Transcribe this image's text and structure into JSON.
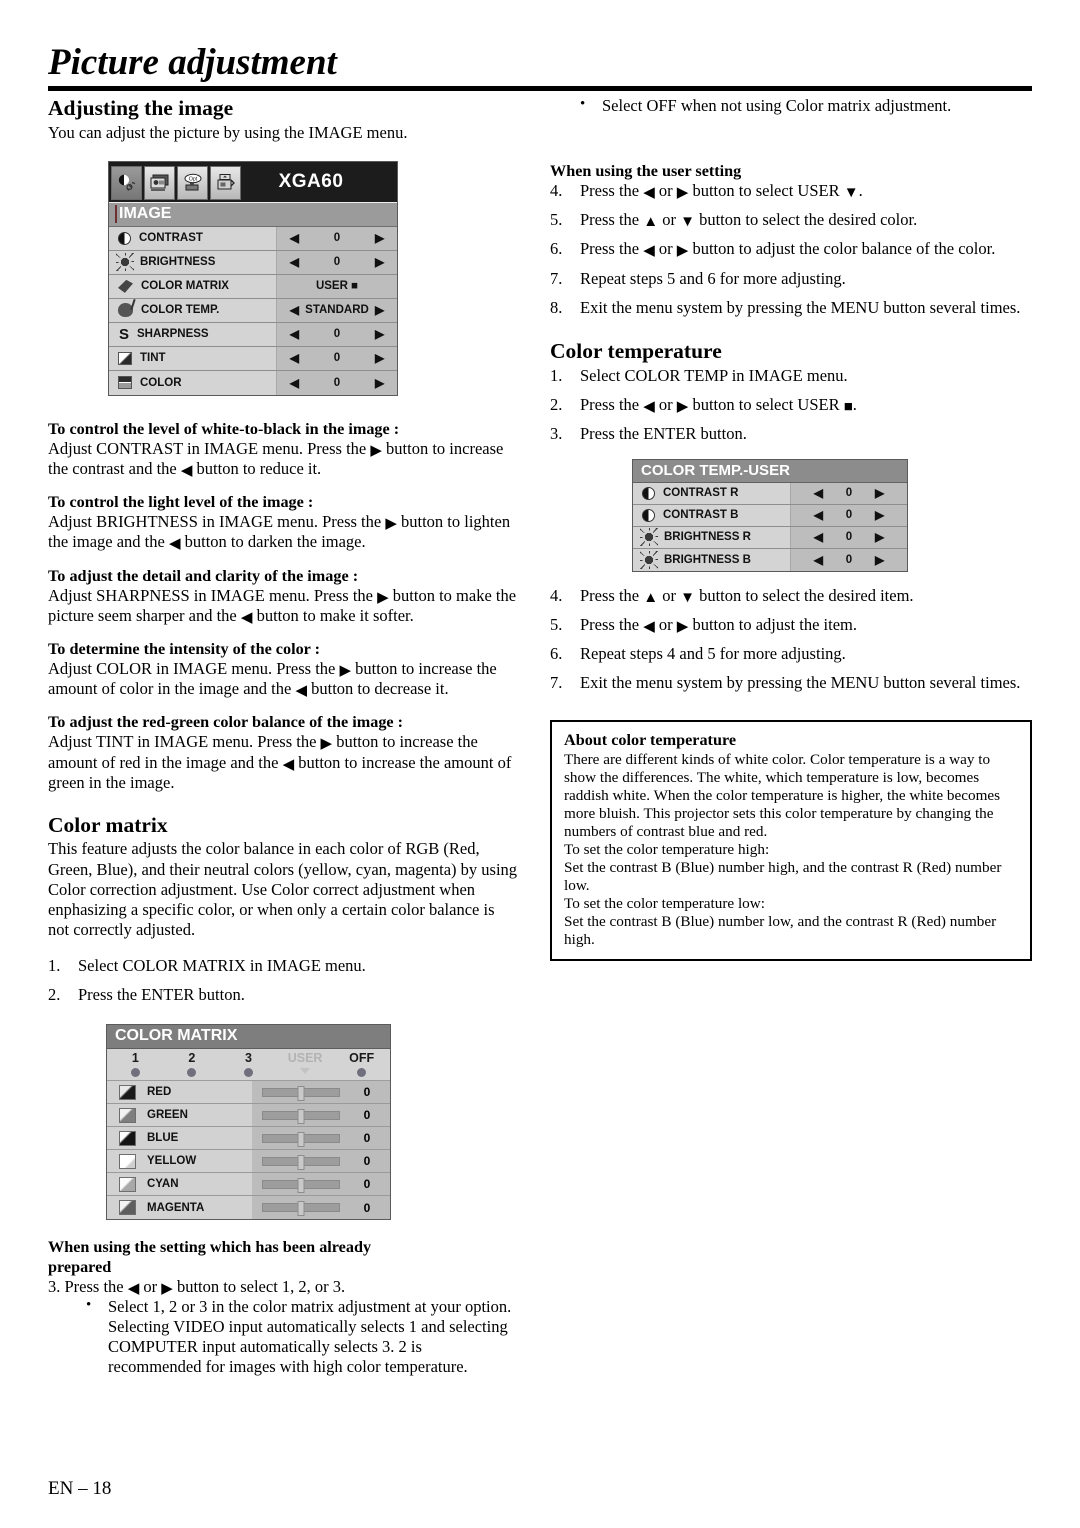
{
  "page": {
    "title": "Picture adjustment",
    "footer": "EN – 18"
  },
  "left_column": {
    "section_adjusting": {
      "heading": "Adjusting the image",
      "intro": "You can adjust the picture by using the IMAGE menu."
    },
    "image_menu": {
      "name": "IMAGE",
      "signal": "XGA60",
      "tabs": [
        "image-tab-icon",
        "display-tab-icon",
        "option-tab-icon",
        "signal-tab-icon"
      ],
      "rows": [
        {
          "icon": "contrast-icon",
          "label": "CONTRAST",
          "value": "0",
          "has_arrows": true
        },
        {
          "icon": "brightness-icon",
          "label": "BRIGHTNESS",
          "value": "0",
          "has_arrows": true
        },
        {
          "icon": "color-matrix-icon",
          "label": "COLOR MATRIX",
          "value": "USER ■",
          "has_arrows": false
        },
        {
          "icon": "color-temp-icon",
          "label": "COLOR TEMP.",
          "value": "STANDARD",
          "has_arrows": true
        },
        {
          "icon": "sharpness-icon",
          "label": "SHARPNESS",
          "value": "0",
          "has_arrows": true
        },
        {
          "icon": "tint-icon",
          "label": "TINT",
          "value": "0",
          "has_arrows": true
        },
        {
          "icon": "color-icon",
          "label": "COLOR",
          "value": "0",
          "has_arrows": true
        }
      ]
    },
    "topics": [
      {
        "heading": "To control the level of white-to-black in the image :",
        "body_parts": [
          {
            "t": "Adjust CONTRAST in IMAGE menu.  Press the "
          },
          {
            "g": "tri-r"
          },
          {
            "t": " button to increase the contrast and the "
          },
          {
            "g": "tri-l"
          },
          {
            "t": " button to reduce it."
          }
        ]
      },
      {
        "heading": "To control the light level of the image :",
        "body_parts": [
          {
            "t": "Adjust BRIGHTNESS in IMAGE menu.  Press the "
          },
          {
            "g": "tri-r"
          },
          {
            "t": " button to lighten the image and the "
          },
          {
            "g": "tri-l"
          },
          {
            "t": " button to darken the image."
          }
        ]
      },
      {
        "heading": "To adjust the detail and clarity of the image :",
        "body_parts": [
          {
            "t": "Adjust SHARPNESS in IMAGE menu.  Press the "
          },
          {
            "g": "tri-r"
          },
          {
            "t": " button to make the picture seem sharper and the "
          },
          {
            "g": "tri-l"
          },
          {
            "t": " button to make it softer."
          }
        ]
      },
      {
        "heading": "To determine the intensity of the color :",
        "body_parts": [
          {
            "t": "Adjust COLOR in IMAGE menu.  Press the "
          },
          {
            "g": "tri-r"
          },
          {
            "t": " button to increase the amount of color in the image and the "
          },
          {
            "g": "tri-l"
          },
          {
            "t": " button to decrease it."
          }
        ]
      },
      {
        "heading": "To adjust the red-green color balance of the image :",
        "body_parts": [
          {
            "t": "Adjust TINT in IMAGE menu.  Press the "
          },
          {
            "g": "tri-r"
          },
          {
            "t": " button to increase the amount of red in the image and the "
          },
          {
            "g": "tri-l"
          },
          {
            "t": " button to increase the amount of green in the image."
          }
        ]
      }
    ],
    "section_color_matrix": {
      "heading": "Color matrix",
      "body": "This feature adjusts the color balance in each color of RGB (Red, Green, Blue), and their neutral colors (yellow, cyan, magenta) by using Color correction adjustment. Use Color correct adjustment when enphasizing a specific color, or when only a certain color balance is not correctly adjusted.",
      "steps": [
        {
          "num": "1.",
          "text": "Select COLOR MATRIX in IMAGE menu."
        },
        {
          "num": "2.",
          "text": "Press the ENTER button."
        }
      ]
    },
    "color_matrix_menu": {
      "name": "COLOR MATRIX",
      "presets": [
        {
          "label": "1",
          "marker": "dot",
          "dim": false
        },
        {
          "label": "2",
          "marker": "dot",
          "dim": false
        },
        {
          "label": "3",
          "marker": "dot",
          "dim": false
        },
        {
          "label": "USER",
          "marker": "triangle",
          "dim": true
        },
        {
          "label": "OFF",
          "marker": "dot",
          "dim": false
        }
      ],
      "rows": [
        {
          "icon": "red-swatch-icon",
          "label": "RED",
          "value": "0"
        },
        {
          "icon": "green-swatch-icon",
          "label": "GREEN",
          "value": "0"
        },
        {
          "icon": "blue-swatch-icon",
          "label": "BLUE",
          "value": "0"
        },
        {
          "icon": "yellow-swatch-icon",
          "label": "YELLOW",
          "value": "0"
        },
        {
          "icon": "cyan-swatch-icon",
          "label": "CYAN",
          "value": "0"
        },
        {
          "icon": "magenta-swatch-icon",
          "label": "MAGENTA",
          "value": "0"
        }
      ]
    },
    "section_prepared": {
      "heading_line1": "When using the setting which has been already",
      "heading_line2": "prepared",
      "step3_parts": [
        {
          "t": "3.  Press the "
        },
        {
          "g": "tri-l"
        },
        {
          "t": " or "
        },
        {
          "g": "tri-r"
        },
        {
          "t": " button to select 1, 2, or 3."
        }
      ],
      "bullet": "Select 1, 2 or 3 in the color matrix adjustment at your option. Selecting VIDEO input automatically selects 1 and selecting COMPUTER input automatically selects 3. 2 is recommended for images with high color temperature."
    }
  },
  "right_column": {
    "bullet_off": "Select OFF when not using Color matrix adjustment.",
    "section_user_setting": {
      "heading": "When using the user setting",
      "steps": [
        {
          "num": "4.",
          "parts": [
            {
              "t": "Press the "
            },
            {
              "g": "tri-l"
            },
            {
              "t": " or "
            },
            {
              "g": "tri-r"
            },
            {
              "t": " button to select USER "
            },
            {
              "g": "tri-d"
            },
            {
              "t": "."
            }
          ]
        },
        {
          "num": "5.",
          "parts": [
            {
              "t": "Press the "
            },
            {
              "g": "tri-u"
            },
            {
              "t": " or "
            },
            {
              "g": "tri-d"
            },
            {
              "t": " button to select the desired color."
            }
          ]
        },
        {
          "num": "6.",
          "parts": [
            {
              "t": "Press the "
            },
            {
              "g": "tri-l"
            },
            {
              "t": " or "
            },
            {
              "g": "tri-r"
            },
            {
              "t": " button to adjust the color balance of the color."
            }
          ]
        },
        {
          "num": "7.",
          "parts": [
            {
              "t": "Repeat steps 5 and 6 for more adjusting."
            }
          ]
        },
        {
          "num": "8.",
          "parts": [
            {
              "t": "Exit the menu system by pressing the MENU button several times."
            }
          ]
        }
      ]
    },
    "section_color_temperature": {
      "heading": "Color temperature",
      "steps_top": [
        {
          "num": "1.",
          "parts": [
            {
              "t": "Select COLOR TEMP in IMAGE menu."
            }
          ]
        },
        {
          "num": "2.",
          "parts": [
            {
              "t": "Press the "
            },
            {
              "g": "tri-l"
            },
            {
              "t": " or "
            },
            {
              "g": "tri-r"
            },
            {
              "t": " button to select USER "
            },
            {
              "g": "sq"
            },
            {
              "t": "."
            }
          ]
        },
        {
          "num": "3.",
          "parts": [
            {
              "t": "Press the ENTER button."
            }
          ]
        }
      ],
      "steps_bottom": [
        {
          "num": "4.",
          "parts": [
            {
              "t": "Press the "
            },
            {
              "g": "tri-u"
            },
            {
              "t": " or "
            },
            {
              "g": "tri-d"
            },
            {
              "t": " button to select the desired item."
            }
          ]
        },
        {
          "num": "5.",
          "parts": [
            {
              "t": "Press the "
            },
            {
              "g": "tri-l"
            },
            {
              "t": " or "
            },
            {
              "g": "tri-r"
            },
            {
              "t": " button to adjust the item."
            }
          ]
        },
        {
          "num": "6.",
          "parts": [
            {
              "t": "Repeat steps 4 and 5 for more adjusting."
            }
          ]
        },
        {
          "num": "7.",
          "parts": [
            {
              "t": "Exit the menu system by pressing the MENU button several times."
            }
          ]
        }
      ]
    },
    "color_temp_menu": {
      "name": "COLOR TEMP.-USER",
      "rows": [
        {
          "icon": "contrast-icon",
          "label": "CONTRAST R",
          "value": "0"
        },
        {
          "icon": "contrast-icon",
          "label": "CONTRAST B",
          "value": "0"
        },
        {
          "icon": "brightness-icon",
          "label": "BRIGHTNESS R",
          "value": "0"
        },
        {
          "icon": "brightness-icon",
          "label": "BRIGHTNESS B",
          "value": "0"
        }
      ]
    },
    "about_box": {
      "heading": "About color temperature",
      "paragraph": "There are different kinds of white color. Color temperature is a way to show the differences. The white, which temperature is low, becomes raddish white. When the color temperature is higher, the white becomes more bluish. This projector sets this color temperature by changing the numbers of contrast blue and red.",
      "line_high_label": "To set the color temperature high:",
      "line_high_body": "Set the contrast B (Blue) number high, and the contrast R (Red) number low.",
      "line_low_label": "To set the color temperature low:",
      "line_low_body": "Set the contrast B (Blue) number low, and the contrast R (Red) number high."
    }
  },
  "colors": {
    "osd_header_dark": "#1c1c1c",
    "osd_subhead": "#9b9b9b",
    "osd_row": "#d4d4d4",
    "osd_value": "#bdbdbd",
    "cm_header": "#7e7e7e",
    "ct_header": "#8c8c8c"
  }
}
